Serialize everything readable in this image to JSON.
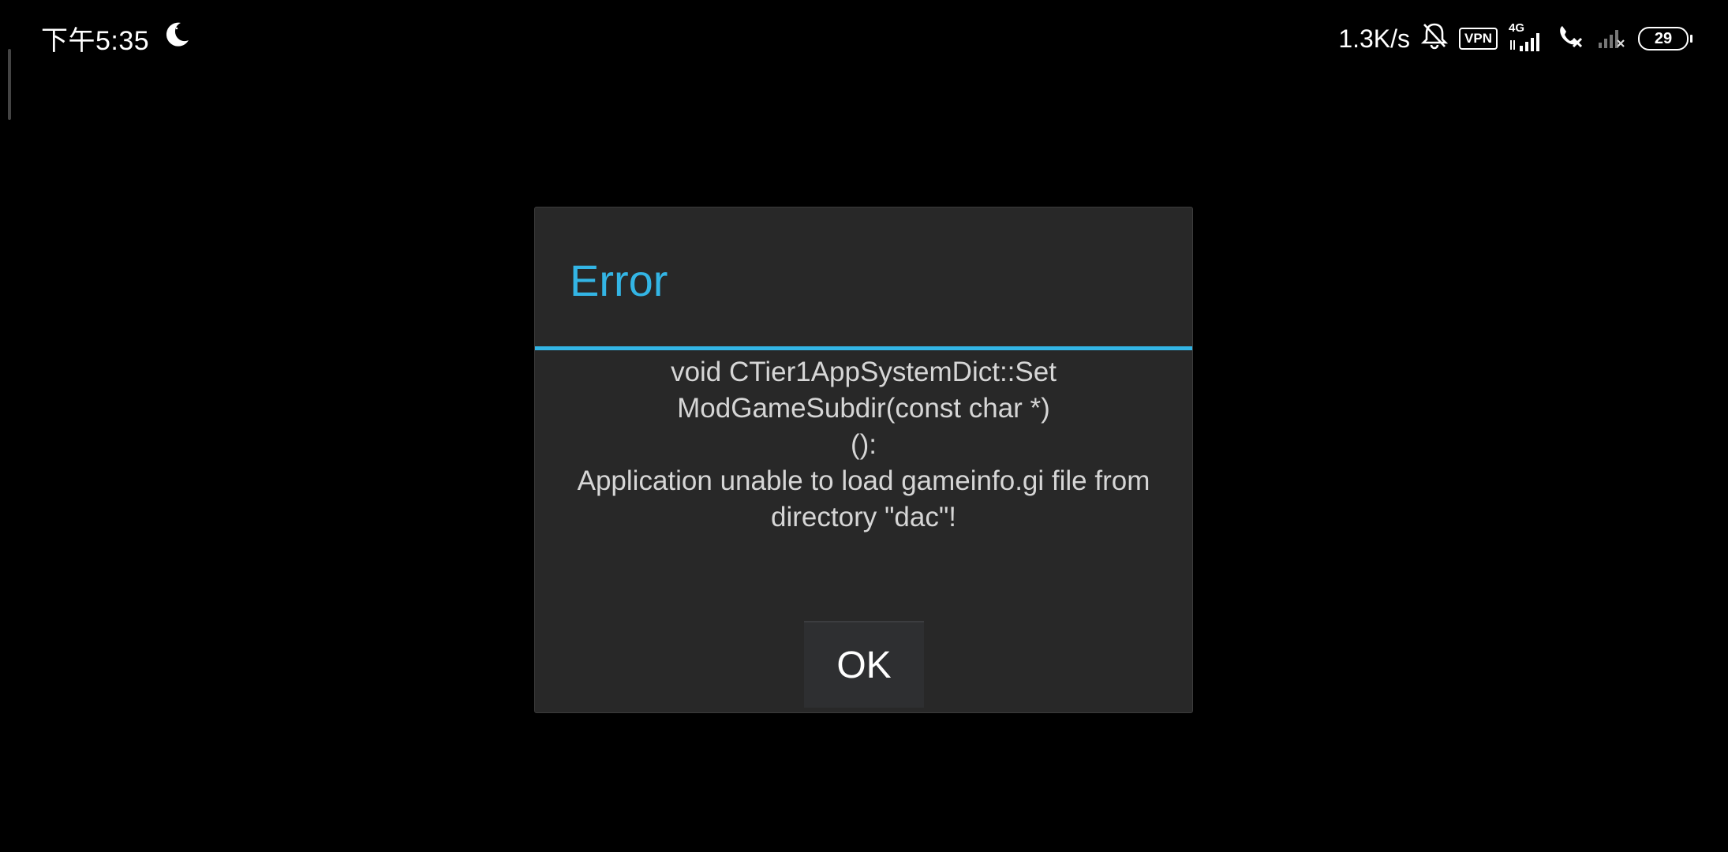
{
  "status_bar": {
    "time": "下午5:35",
    "moon_icon": "moon-icon",
    "network_speed": "1.3K/s",
    "bell_muted_icon": "bell-muted-icon",
    "vpn_label": "VPN",
    "network_type": "4G",
    "signal_icon": "signal-bars-icon",
    "call_icon": "call-missed-icon",
    "signal2_icon": "no-signal-icon",
    "battery_level": "29"
  },
  "dialog": {
    "title": "Error",
    "message_lines": [
      "void CTier1AppSystemDict::Set",
      "ModGameSubdir(const char *)",
      "():",
      "Application unable to load gameinfo.gi file from",
      "directory \"dac\"!"
    ],
    "ok_label": "OK"
  },
  "colors": {
    "accent": "#33b5e5",
    "dialog_bg": "#282828",
    "background": "#000000"
  }
}
